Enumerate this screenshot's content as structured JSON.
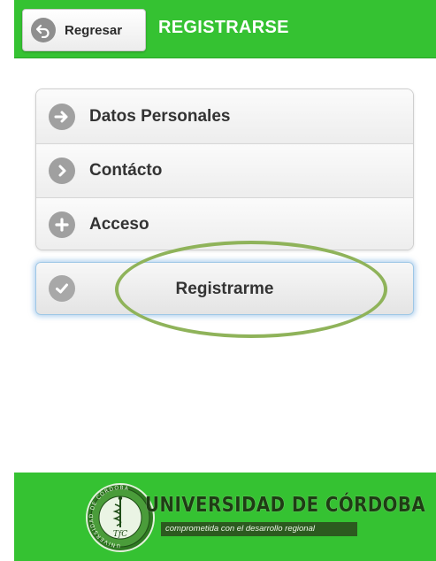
{
  "header": {
    "back_button_label": "Regresar",
    "title": "REGISTRARSE",
    "back_icon": "undo-arrow-icon"
  },
  "menu": {
    "items": [
      {
        "label": "Datos Personales",
        "icon": "arrow-right-circle-icon"
      },
      {
        "label": "Contácto",
        "icon": "chevron-right-circle-icon"
      },
      {
        "label": "Acceso",
        "icon": "plus-circle-icon"
      }
    ]
  },
  "register_button": {
    "label": "Registrarme",
    "icon": "check-circle-icon"
  },
  "footer": {
    "university_name": "UNIVERSIDAD DE CÓRDOBA",
    "tagline": "comprometida con el desarrollo regional",
    "seal_text": "UNIVERSIDAD DE CÓRDOBA",
    "seal_monogram": "TfC"
  },
  "colors": {
    "header_green": "#35c232",
    "footer_green": "#35c232",
    "highlight_ellipse": "#8fb35a",
    "focus_glow": "#78afe1"
  }
}
